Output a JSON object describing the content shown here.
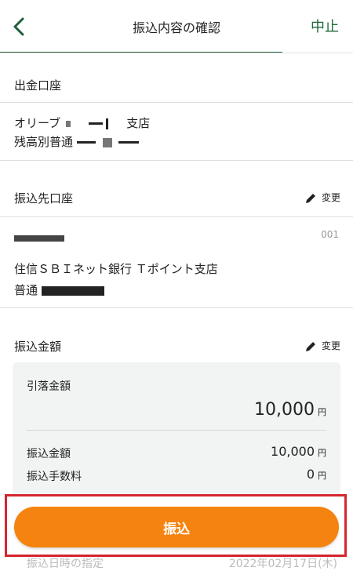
{
  "header": {
    "title": "振込内容の確認",
    "cancel_label": "中止"
  },
  "source": {
    "section_label": "出金口座",
    "branch_prefix": "オリーブ",
    "branch_suffix": "支店",
    "account_type": "残高別普通"
  },
  "destination": {
    "section_label": "振込先口座",
    "edit_label": "変更",
    "bank_code": "001",
    "bank_branch": "住信ＳＢＩネット銀行 Ｔポイント支店",
    "account_type": "普通"
  },
  "amount": {
    "section_label": "振込金額",
    "edit_label": "変更",
    "withdraw_label": "引落金額",
    "withdraw_value": "10,000",
    "transfer_label": "振込金額",
    "transfer_value": "10,000",
    "fee_label": "振込手数料",
    "fee_value": "0",
    "currency": "円"
  },
  "submit_label": "振込",
  "faded": {
    "row_label": "振込日時の指定",
    "date_value": "2022年02月17日(木)"
  },
  "colors": {
    "accent_green": "#1f5e3a",
    "button_orange": "#f5830f",
    "highlight_red": "#d5252e"
  }
}
